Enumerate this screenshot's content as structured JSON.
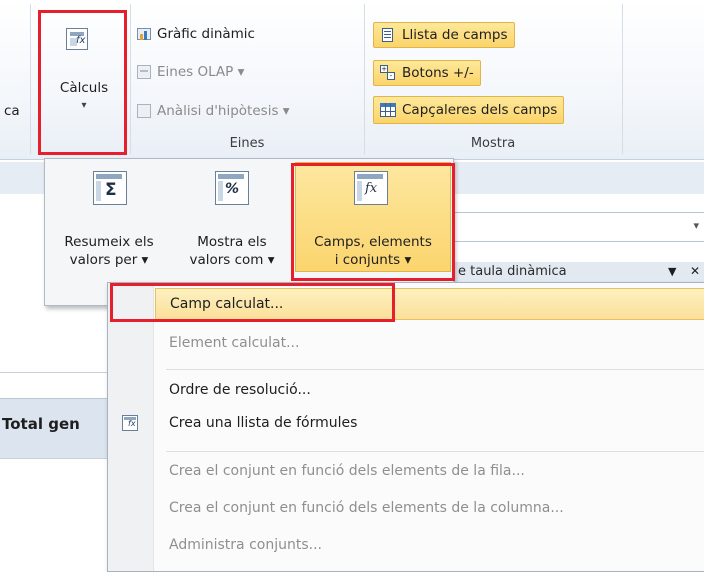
{
  "ribbon": {
    "partial_label": "ca",
    "calc_button": {
      "label": "Càlculs",
      "arrow": "▾"
    },
    "eines": {
      "items": [
        {
          "label": "Gràfic dinàmic",
          "enabled": true
        },
        {
          "label": "Eines OLAP ▾",
          "enabled": false
        },
        {
          "label": "Anàlisi d'hipòtesis ▾",
          "enabled": false
        }
      ],
      "group_label": "Eines"
    },
    "mostra": {
      "items": [
        {
          "label": "Llista de camps"
        },
        {
          "label": "Botons +/-"
        },
        {
          "label": "Capçaleres dels camps"
        }
      ],
      "group_label": "Mostra"
    }
  },
  "calc_dropdown": {
    "buttons": [
      {
        "line1": "Resumeix els",
        "line2": "valors per ▾",
        "glyph": "Σ"
      },
      {
        "line1": "Mostra els",
        "line2": "valors com ▾",
        "glyph": "%"
      },
      {
        "line1": "Camps, elements",
        "line2": "i conjunts ▾",
        "glyph": "fx"
      }
    ]
  },
  "sheet": {
    "partial_header_text": "e taula dinàmica",
    "header_arrow": "▼",
    "header_close": "✕",
    "cell_text": "Total gen"
  },
  "menu": {
    "items": [
      {
        "label": "Camp calculat...",
        "enabled": true
      },
      {
        "label": "Element calculat...",
        "enabled": false
      },
      {
        "label": "Ordre de resolució...",
        "enabled": true
      },
      {
        "label": "Crea una llista de fórmules",
        "enabled": true
      },
      {
        "label": "Crea el conjunt en funció dels elements de la fila...",
        "enabled": false
      },
      {
        "label": "Crea el conjunt en funció dels elements de la columna...",
        "enabled": false
      },
      {
        "label": "Administra conjunts...",
        "enabled": false
      }
    ]
  },
  "colors": {
    "highlight": "#e51f2c",
    "hover": "#fbe09a",
    "ribbon_bg": "#f4f7fb"
  }
}
